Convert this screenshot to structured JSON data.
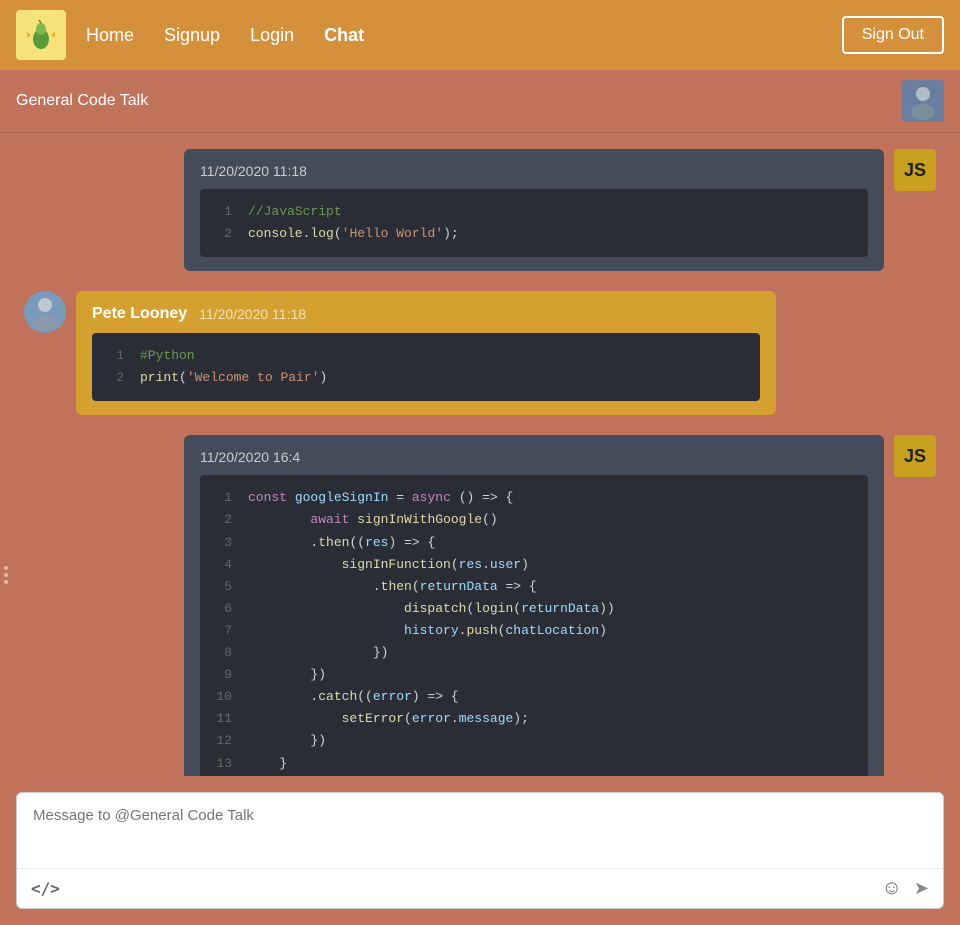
{
  "navbar": {
    "links": [
      {
        "label": "Home",
        "active": false
      },
      {
        "label": "Signup",
        "active": false
      },
      {
        "label": "Login",
        "active": false
      },
      {
        "label": "Chat",
        "active": true
      }
    ],
    "signout_label": "Sign Out"
  },
  "chat": {
    "channel_name": "General Code Talk",
    "messages": [
      {
        "id": "msg1",
        "side": "right",
        "badge": "JS",
        "timestamp": "11/20/2020 11:18",
        "code_lines": [
          {
            "num": "1",
            "raw": "//JavaScript"
          },
          {
            "num": "2",
            "raw": "console.log('Hello World');"
          }
        ]
      },
      {
        "id": "msg2",
        "side": "left",
        "username": "Pete Looney",
        "timestamp": "11/20/2020 11:18",
        "code_lines": [
          {
            "num": "1",
            "raw": "#Python"
          },
          {
            "num": "2",
            "raw": "print('Welcome to Pair')"
          }
        ]
      },
      {
        "id": "msg3",
        "side": "right",
        "badge": "JS",
        "timestamp": "11/20/2020 16:4",
        "code_lines": [
          {
            "num": "1",
            "raw": "const googleSignIn = async () => {"
          },
          {
            "num": "2",
            "raw": "        await signInWithGoogle()"
          },
          {
            "num": "3",
            "raw": "        .then((res) => {"
          },
          {
            "num": "4",
            "raw": "            signInFunction(res.user)"
          },
          {
            "num": "5",
            "raw": "                .then(returnData => {"
          },
          {
            "num": "6",
            "raw": "                    dispatch(login(returnData))"
          },
          {
            "num": "7",
            "raw": "                    history.push(chatLocation)"
          },
          {
            "num": "8",
            "raw": "                })"
          },
          {
            "num": "9",
            "raw": "        })"
          },
          {
            "num": "10",
            "raw": "        .catch((error) => {"
          },
          {
            "num": "11",
            "raw": "            setError(error.message);"
          },
          {
            "num": "12",
            "raw": "        })"
          },
          {
            "num": "13",
            "raw": "    }"
          }
        ]
      }
    ],
    "input_placeholder": "Message to @General Code Talk",
    "toolbar": {
      "code_icon": "</>",
      "emoji_icon": "☺",
      "send_icon": "➤"
    }
  }
}
